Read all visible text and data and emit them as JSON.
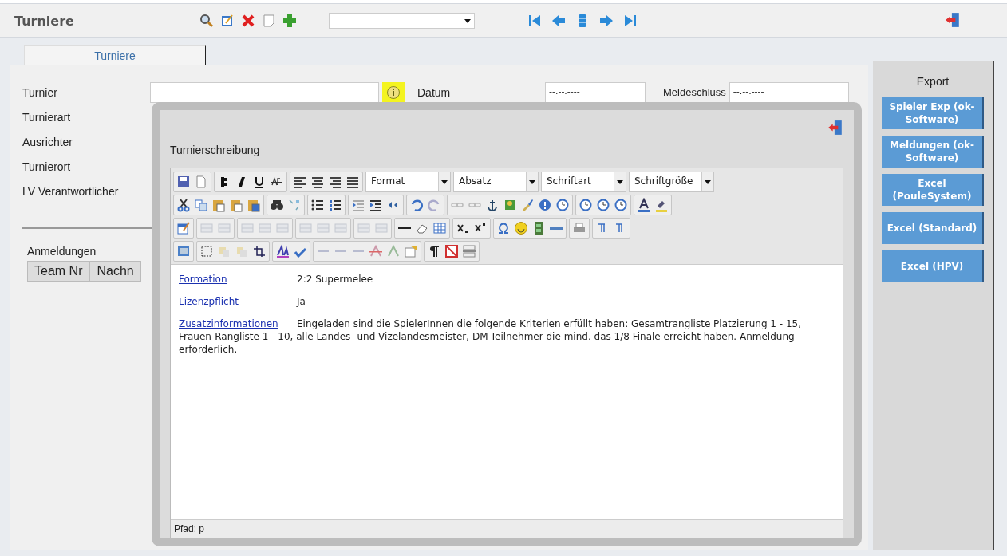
{
  "header": {
    "title": "Turniere"
  },
  "tabs": [
    {
      "label": "Turniere",
      "selected": true
    }
  ],
  "form": {
    "fields": [
      {
        "label": "Turnier"
      },
      {
        "label": "Turnierart"
      },
      {
        "label": "Ausrichter"
      },
      {
        "label": "Turnierort"
      },
      {
        "label": "LV Verantwortlicher"
      }
    ],
    "date_fields": [
      {
        "label": "Datum",
        "value": "--.--.----"
      },
      {
        "label": "Meldeschluss",
        "value": "--.--.----"
      }
    ]
  },
  "registrations": {
    "title": "Anmeldungen",
    "columns": [
      "Team Nr",
      "Nachn"
    ]
  },
  "export": {
    "title": "Export",
    "buttons": [
      "Spieler Exp (ok-Software)",
      "Meldungen (ok-Software)",
      "Excel (PouleSystem)",
      "Excel (Standard)",
      "Excel (HPV)"
    ]
  },
  "dialog": {
    "title": "Turnierschreibung",
    "toolbar_selects": [
      "Format",
      "Absatz",
      "Schriftart",
      "Schriftgröße"
    ],
    "content": [
      {
        "link": "Formation",
        "text": "2:2 Supermelee"
      },
      {
        "link": "Lizenzpflicht",
        "text": "Ja"
      },
      {
        "link": "Zusatzinformationen",
        "text": "Eingeladen sind die SpielerInnen die folgende Kriterien erfüllt haben: Gesamtrangliste Platzierung 1 - 15, Frauen-Rangliste 1 - 10, alle Landes- und Vizelandesmeister, DM-Teilnehmer die mind. das 1/8 Finale erreicht haben. Anmeldung erforderlich."
      }
    ],
    "path": "Pfad: p"
  }
}
